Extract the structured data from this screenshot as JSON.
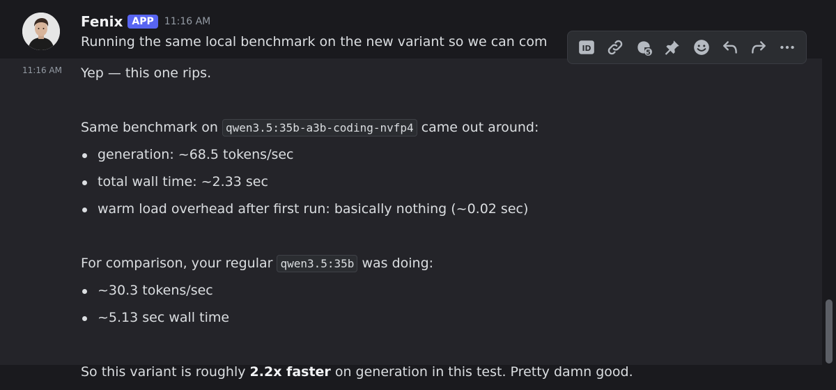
{
  "message_header": {
    "author": "Fenix",
    "badge": "APP",
    "timestamp": "11:16 AM"
  },
  "first_line": "Running the same local benchmark on the new variant so we can com",
  "second_message": {
    "side_timestamp": "11:16 AM",
    "intro": "Yep — this one rips.",
    "bench_prefix": "Same benchmark on ",
    "bench_code": "qwen3.5:35b-a3b-coding-nvfp4",
    "bench_suffix": " came out around:",
    "bench_bullets": [
      "generation: ~68.5 tokens/sec",
      "total wall time: ~2.33 sec",
      "warm load overhead after first run: basically nothing (~0.02 sec)"
    ],
    "compare_prefix": "For comparison, your regular ",
    "compare_code": "qwen3.5:35b",
    "compare_suffix": " was doing:",
    "compare_bullets": [
      "~30.3 tokens/sec",
      "~5.13 sec wall time"
    ],
    "summary_prefix": "So this variant is roughly ",
    "summary_bold": "2.2x faster",
    "summary_suffix": " on generation in this test. Pretty damn good."
  },
  "toolbar": {
    "icons": [
      "id-icon",
      "link-icon",
      "thread-icon",
      "pin-icon",
      "emoji-icon",
      "reply-icon",
      "forward-icon",
      "more-icon"
    ]
  },
  "colors": {
    "background": "#1a1a1e",
    "hover_background": "#242429",
    "badge": "#5865f2",
    "text": "#dbdee1",
    "muted": "#949ba4"
  }
}
